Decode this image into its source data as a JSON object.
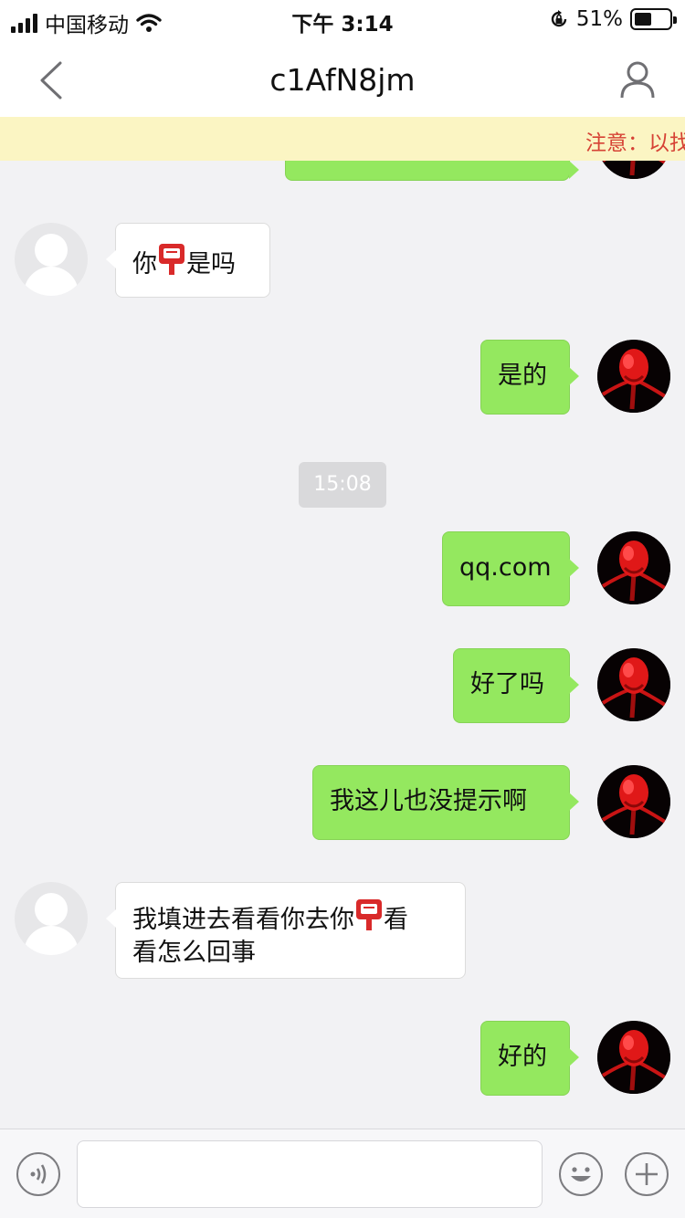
{
  "status_bar": {
    "carrier": "中国移动",
    "time": "下午 3:14",
    "battery_percent": "51%",
    "battery_level": 0.51
  },
  "nav": {
    "title": "c1AfN8jm",
    "back_icon": "chevron-left-icon",
    "profile_icon": "person-icon"
  },
  "notice": {
    "text": "注意：以找"
  },
  "messages": [
    {
      "id": "m1",
      "from": "other",
      "parts": [
        "你",
        "postbox",
        "是吗"
      ]
    },
    {
      "id": "m2",
      "from": "me",
      "text": "是的"
    },
    {
      "id": "ts1",
      "type": "timestamp",
      "text": "15:08"
    },
    {
      "id": "m3",
      "from": "me",
      "text": "qq.com"
    },
    {
      "id": "m4",
      "from": "me",
      "text": "好了吗"
    },
    {
      "id": "m5",
      "from": "me",
      "text": "我这儿也没提示啊"
    },
    {
      "id": "m6",
      "from": "other",
      "line1": [
        "我填进去看看你去你",
        "postbox",
        "看"
      ],
      "line2": "看怎么回事"
    },
    {
      "id": "m7",
      "from": "me",
      "text": "好的"
    }
  ],
  "input_bar": {
    "voice_icon": "voice-icon",
    "emoji_icon": "emoji-icon",
    "plus_icon": "plus-icon",
    "input_value": ""
  },
  "colors": {
    "my_bubble": "#94e85f",
    "other_bubble": "#ffffff",
    "background": "#f2f2f4",
    "notice_bg": "#fbf5c3",
    "notice_text": "#d64235"
  }
}
